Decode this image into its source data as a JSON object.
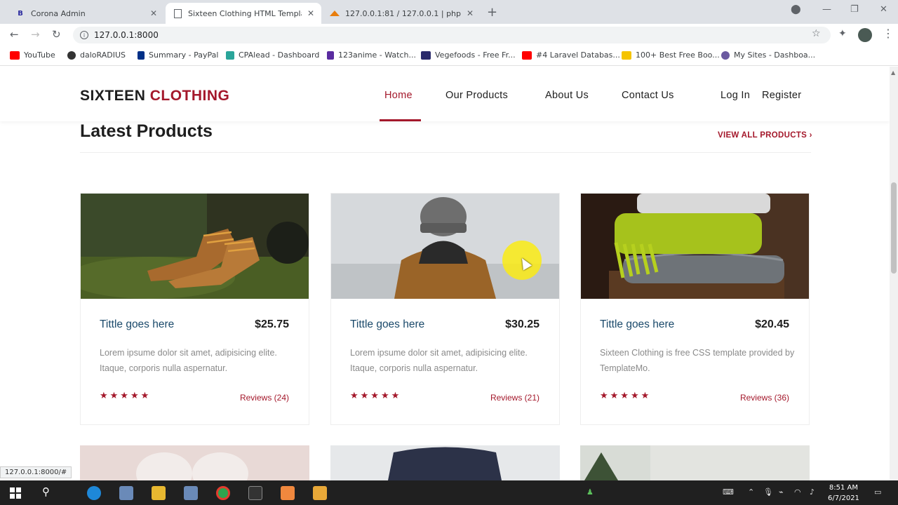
{
  "browser": {
    "tabs": [
      {
        "title": "Corona Admin",
        "icon": "B",
        "icon_color": "#2b2b9f"
      },
      {
        "title": "Sixteen Clothing HTML Template",
        "icon": "doc",
        "icon_color": "#5f6368"
      },
      {
        "title": "127.0.0.1:81 / 127.0.0.1 | phpMyA...",
        "icon": "pma",
        "icon_color": "#e87d0d"
      }
    ],
    "url": "127.0.0.1:8000",
    "bookmarks": [
      {
        "label": "YouTube",
        "color": "#ff0000"
      },
      {
        "label": "daloRADIUS",
        "color": "#333333"
      },
      {
        "label": "Summary - PayPal",
        "color": "#003087"
      },
      {
        "label": "CPAlead - Dashboard",
        "color": "#2aa59a"
      },
      {
        "label": "123anime - Watch...",
        "color": "#5a2ca0"
      },
      {
        "label": "Vegefoods - Free Fr...",
        "color": "#2b2b6b"
      },
      {
        "label": "#4 Laravel Databas...",
        "color": "#ff0000"
      },
      {
        "label": "100+ Best Free Boo...",
        "color": "#f5c400"
      },
      {
        "label": "My Sites - Dashboa...",
        "color": "#6b5aa0"
      }
    ]
  },
  "site": {
    "logo_part1": "SIXTEEN",
    "logo_part2": "CLOTHING",
    "accent_color": "#a4182b",
    "nav": [
      "Home",
      "Our Products",
      "About Us",
      "Contact Us",
      "Log In",
      "Register"
    ],
    "active_nav": "Home"
  },
  "section": {
    "title": "Latest Products",
    "view_all": "VIEW ALL PRODUCTS ›"
  },
  "products": [
    {
      "title": "Tittle goes here",
      "price": "$25.75",
      "desc": "Lorem ipsume dolor sit amet, adipisicing elite. Itaque, corporis nulla aspernatur.",
      "stars": "★★★★★",
      "reviews": "Reviews (24)",
      "image": "boots"
    },
    {
      "title": "Tittle goes here",
      "price": "$30.25",
      "desc": "Lorem ipsume dolor sit amet, adipisicing elite. Itaque, corporis nulla aspernatur.",
      "stars": "★★★★★",
      "reviews": "Reviews (21)",
      "image": "person-beanie"
    },
    {
      "title": "Tittle goes here",
      "price": "$20.45",
      "desc": "Sixteen Clothing is free CSS template provided by TemplateMo.",
      "stars": "★★★★★",
      "reviews": "Reviews (36)",
      "image": "folded-knits"
    }
  ],
  "status_url": "127.0.0.1:8000/#",
  "clock": {
    "time": "8:51 AM",
    "date": "6/7/2021"
  }
}
